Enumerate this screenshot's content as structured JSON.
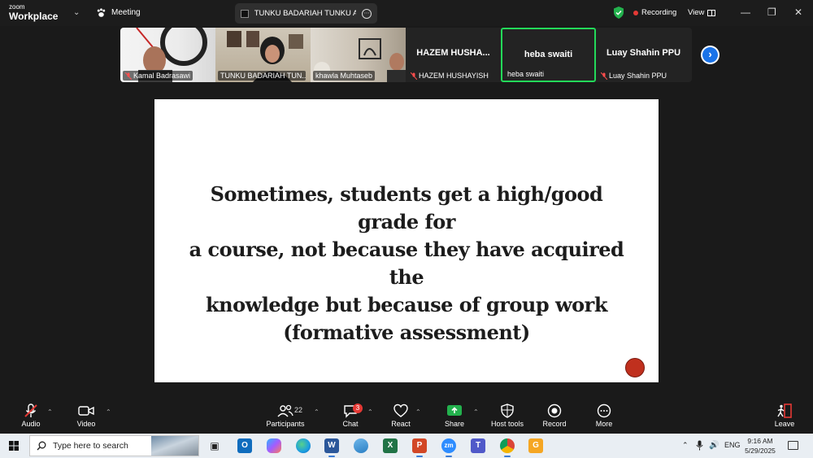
{
  "app": {
    "logo_top": "zoom",
    "logo_bottom": "Workplace",
    "meeting_label": "Meeting",
    "sharer_name": "TUNKU BADARIAH TUNKU AHMAD",
    "recording_label": "Recording",
    "view_label": "View"
  },
  "participants": [
    {
      "name": "Kamal Badrasawi",
      "muted": true,
      "video": true
    },
    {
      "name": "TUNKU BADARIAH TUN...",
      "muted": false,
      "video": true
    },
    {
      "name": "khawla Muhtaseb",
      "muted": false,
      "video": true
    },
    {
      "display": "HAZEM  HUSHA...",
      "name": "HAZEM HUSHAYISH",
      "muted": true,
      "video": false
    },
    {
      "display": "heba swaiti",
      "name": "heba swaiti",
      "muted": false,
      "video": false,
      "active_speaker": true
    },
    {
      "display": "Luay Shahin PPU",
      "name": "Luay Shahin PPU",
      "muted": true,
      "video": false
    }
  ],
  "slide": {
    "lines": [
      "Sometimes, students get a high/good grade for",
      "a course, not because they have acquired the",
      "knowledge but because of group work",
      "(formative assessment)"
    ]
  },
  "toolbar": {
    "audio": "Audio",
    "video": "Video",
    "participants": "Participants",
    "participants_count": "22",
    "chat": "Chat",
    "chat_badge": "3",
    "react": "React",
    "share": "Share",
    "host_tools": "Host tools",
    "record": "Record",
    "more": "More",
    "leave": "Leave"
  },
  "taskbar": {
    "search_placeholder": "Type here to search",
    "apps": [
      {
        "name": "task-view",
        "label": ""
      },
      {
        "name": "outlook",
        "label": "O",
        "color": "#0f6cbd"
      },
      {
        "name": "copilot",
        "label": "",
        "color": "#7b61ff"
      },
      {
        "name": "edge",
        "label": "",
        "color": "#1b9de2"
      },
      {
        "name": "word",
        "label": "W",
        "color": "#2b579a"
      },
      {
        "name": "photos",
        "label": "",
        "color": "#4aa3df"
      },
      {
        "name": "excel",
        "label": "X",
        "color": "#217346"
      },
      {
        "name": "powerpoint",
        "label": "P",
        "color": "#d24726"
      },
      {
        "name": "zoom",
        "label": "zm",
        "color": "#2d8cff"
      },
      {
        "name": "teams",
        "label": "T",
        "color": "#5059c9"
      },
      {
        "name": "chrome",
        "label": "",
        "color": "#db4437"
      },
      {
        "name": "presentation-app",
        "label": "G",
        "color": "#f5a623"
      }
    ],
    "language": "ENG",
    "time": "9:16 AM",
    "date": "5/29/2025"
  }
}
